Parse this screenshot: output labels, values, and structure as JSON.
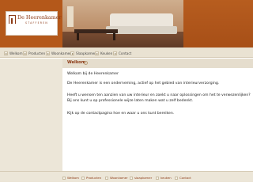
{
  "logo": {
    "title": "De Heerenkamer",
    "subtitle": "STAFFEREN",
    "alt": "De Heerenkamer logo"
  },
  "nav": {
    "items": [
      "Welkom",
      "Producten",
      "Woonkamer",
      "Slaapkamer",
      "Keuken",
      "Contact"
    ]
  },
  "page": {
    "title": "Welkom",
    "paragraphs": [
      "Welkom bij de Heerenkamer",
      "De Heerenkamer is een onderneming, actief op het gebied van interieurverzorging.",
      "Heeft u wensen ten aanzien van uw interieur en zoekt u naar oplossingen om het te verwezenlijken?",
      "Bij ons kunt u op professionele wijze laten maken wat u zelf bedenkt.",
      "Kijk op de contactpagina hoe en waar u ons kunt bereiken."
    ]
  },
  "footer": {
    "items": [
      "Welkom",
      "Producten",
      "Woonkamer",
      "slaapkamer",
      "keuken",
      "Contact"
    ]
  },
  "colors": {
    "brand": "#b4581a",
    "accent_text": "#8c3a16",
    "nav_bg": "#e9e2d2"
  }
}
